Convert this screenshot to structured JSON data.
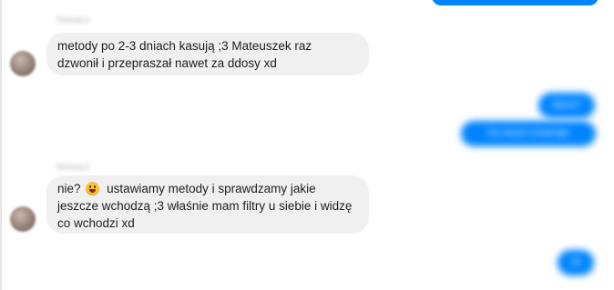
{
  "conversation": {
    "outgoing_top_partial": "",
    "group1": {
      "sender_name": "Nosacz",
      "avatar_icon": "user-avatar-icon",
      "message_lines": [
        "metody po 2-3 dniach kasują ;3 Mateuszek raz",
        "dzwonił i przepraszał nawet za ddosy xd"
      ]
    },
    "outgoing1": {
      "text": "Ilpssx?"
    },
    "outgoing2": {
      "text": "No ranszt vnnamaje"
    },
    "group2": {
      "sender_name": "Nosacz",
      "avatar_icon": "user-avatar-icon",
      "line1_before_emoji": "nie?",
      "emoji": "grinning-face-emoji",
      "line1_after_emoji": "ustawiamy metody i sprawdzamy jakie",
      "line2": "jeszcze wchodzą ;3 właśnie mam filtry u siebie i widzę",
      "line3": "co wchodzi xd"
    },
    "outgoing3": {
      "text": "ok"
    }
  },
  "colors": {
    "incoming_bubble": "#f1f0f0",
    "outgoing_bubble": "#0084ff",
    "text": "#1c1e21"
  }
}
